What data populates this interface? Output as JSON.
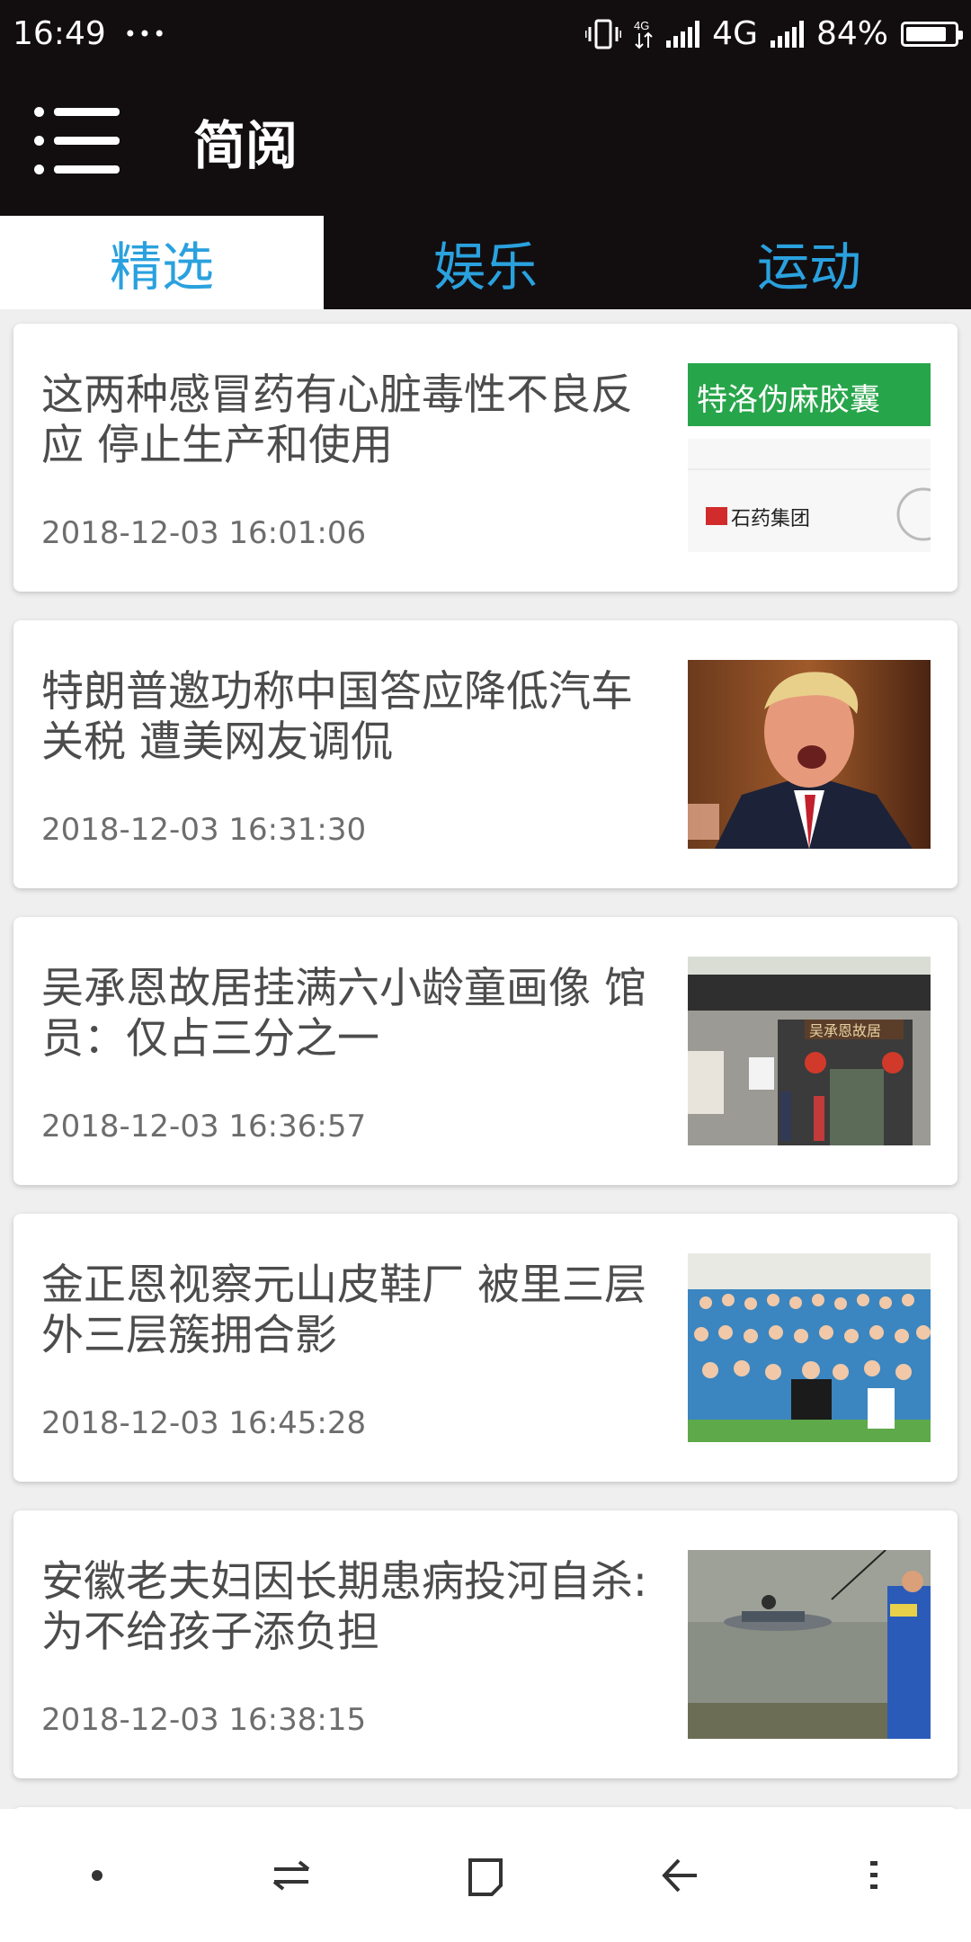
{
  "status_bar": {
    "time": "16:49",
    "dots": "•••",
    "net1": "4G",
    "battery": "84%",
    "battery_level": 0.84
  },
  "app_bar": {
    "title": "简阅"
  },
  "tabs": [
    {
      "label": "精选",
      "active": true
    },
    {
      "label": "娱乐",
      "active": false
    },
    {
      "label": "运动",
      "active": false
    }
  ],
  "news": [
    {
      "title": "这两种感冒药有心脏毒性不良反应 停止生产和使用",
      "time": "2018-12-03 16:01:06",
      "thumb": "medicine-box-image"
    },
    {
      "title": "特朗普邀功称中国答应降低汽车关税 遭美网友调侃",
      "time": "2018-12-03 16:31:30",
      "thumb": "politician-portrait-image"
    },
    {
      "title": "吴承恩故居挂满六小龄童画像 馆员：仅占三分之一",
      "time": "2018-12-03 16:36:57",
      "thumb": "historic-residence-image"
    },
    {
      "title": "金正恩视察元山皮鞋厂 被里三层外三层簇拥合影",
      "time": "2018-12-03 16:45:28",
      "thumb": "factory-crowd-image"
    },
    {
      "title": "安徽老夫妇因长期患病投河自杀:为不给孩子添负担",
      "time": "2018-12-03 16:38:15",
      "thumb": "river-rescue-image"
    }
  ],
  "thumb_texts": {
    "med_brand": "石药集团",
    "med_name": "特洛伪麻胶囊",
    "house_plaque": "吴承恩故居"
  },
  "nav_buttons": [
    "dot",
    "switch",
    "home",
    "back",
    "more"
  ]
}
